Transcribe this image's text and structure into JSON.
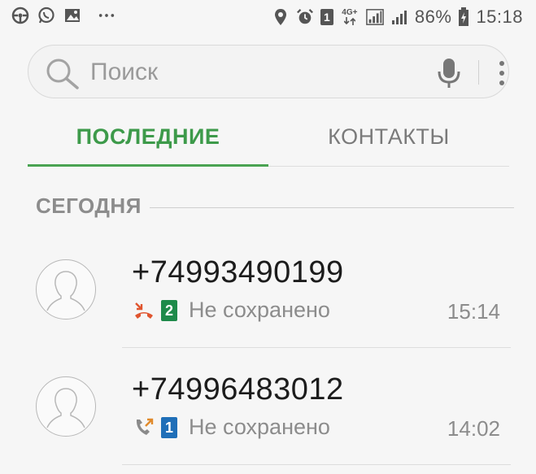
{
  "status_bar": {
    "left_icons": [
      "steering-wheel-icon",
      "whatsapp-icon",
      "gallery-icon",
      "more-notifications-icon"
    ],
    "sim_badge": "1",
    "network_type": "4G+",
    "battery": "86%",
    "time": "15:18"
  },
  "search": {
    "placeholder": "Поиск"
  },
  "tabs": [
    {
      "label": "ПОСЛЕДНИЕ",
      "active": true
    },
    {
      "label": "КОНТАКТЫ",
      "active": false
    }
  ],
  "colors": {
    "accent_green": "#3d9a4a",
    "missed_red": "#e0552f",
    "outgoing_orange": "#e08a2c",
    "sim2_green": "#1e8a4a",
    "sim1_blue": "#1f6fb8"
  },
  "calls": {
    "section_label": "СЕГОДНЯ",
    "items": [
      {
        "number": "+74993490199",
        "call_type": "missed-call-icon",
        "sim": "2",
        "status": "Не сохранено",
        "time": "15:14"
      },
      {
        "number": "+74996483012",
        "call_type": "outgoing-call-icon",
        "sim": "1",
        "status": "Не сохранено",
        "time": "14:02"
      }
    ]
  }
}
